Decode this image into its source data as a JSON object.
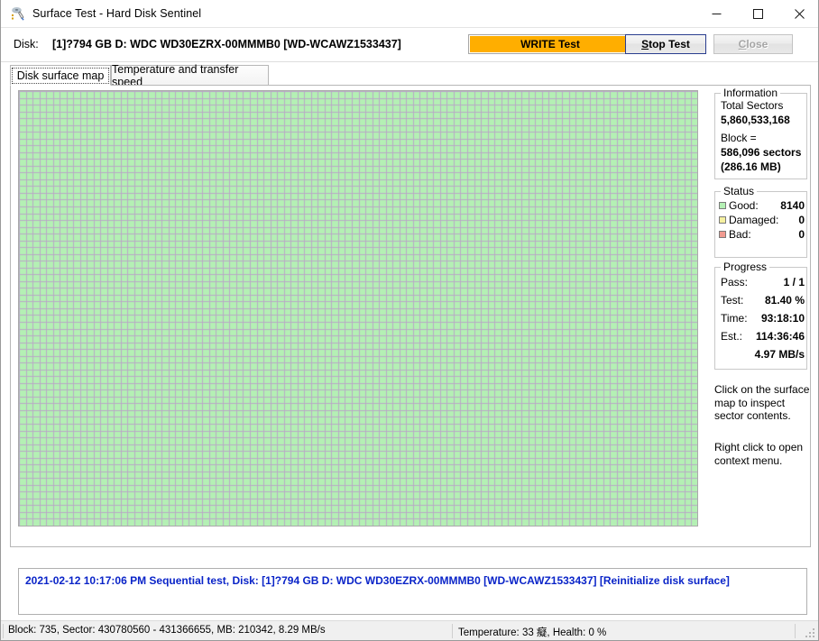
{
  "window": {
    "title": "Surface Test - Hard Disk Sentinel",
    "icon": "disk-test-icon",
    "minimize_label": "—",
    "maximize_label": "□",
    "close_label": "✕"
  },
  "toolbar": {
    "disk_label": "Disk:",
    "disk_value": "[1]?794 GB D: WDC WD30EZRX-00MMMB0 [WD-WCAWZ1533437]",
    "write_test_label": "WRITE Test",
    "stop_test_label": "Stop Test",
    "stop_test_accel": "S",
    "close_label": "Close",
    "close_accel": "C",
    "save_icon": "floppy-save-icon",
    "write_test_color": "#ffae00",
    "stop_focus_color": "#2a3d8f",
    "close_disabled_color": "#a6a6a6"
  },
  "tabs": [
    {
      "label": "Disk surface map",
      "active": true
    },
    {
      "label": "Temperature and transfer speed",
      "active": false
    }
  ],
  "surface_map": {
    "cols": 100,
    "rows": 64,
    "cell": 7.53,
    "good_blocks": 8140,
    "cursor_index": 8140,
    "good_color": "#b4f0b4",
    "grid_color": "#b6b6b6",
    "grid_color_green": "#b9a8c6",
    "untested_color": "#ffffff",
    "cursor_color": "#0d1f8a",
    "damaged_color": "#f5f0a0",
    "bad_color": "#f09a90"
  },
  "information": {
    "group_title": "Information",
    "total_sectors_label": "Total Sectors",
    "total_sectors_value": "5,860,533,168",
    "block_label": "Block =",
    "block_sectors": "586,096 sectors",
    "block_size": "(286.16 MB)"
  },
  "status": {
    "group_title": "Status",
    "rows": [
      {
        "label": "Good:",
        "value": "8140",
        "color": "#b4f0b4"
      },
      {
        "label": "Damaged:",
        "value": "0",
        "color": "#f5f0a0"
      },
      {
        "label": "Bad:",
        "value": "0",
        "color": "#f09a90"
      }
    ]
  },
  "progress": {
    "group_title": "Progress",
    "rows": [
      {
        "label": "Pass:",
        "value": "1 / 1"
      },
      {
        "label": "Test:",
        "value": "81.40 %"
      },
      {
        "label": "Time:",
        "value": "93:18:10"
      },
      {
        "label": "Est.:",
        "value": "114:36:46"
      }
    ],
    "speed": "4.97 MB/s"
  },
  "hints": {
    "hint_1": "Click on the surface map to inspect sector contents.",
    "hint_2": "Right click to open context menu."
  },
  "log": {
    "entry": "2021-02-12  10:17:06 PM   Sequential test, Disk: [1]?794 GB D: WDC WD30EZRX-00MMMB0 [WD-WCAWZ1533437] [Reinitialize disk surface]",
    "color": "#0a24c8"
  },
  "statusbar": {
    "left": "Block: 735, Sector: 430780560 - 431366655, MB: 210342, 8.29 MB/s",
    "middle": "Temperature: 33 癡, Health: 0 %"
  }
}
